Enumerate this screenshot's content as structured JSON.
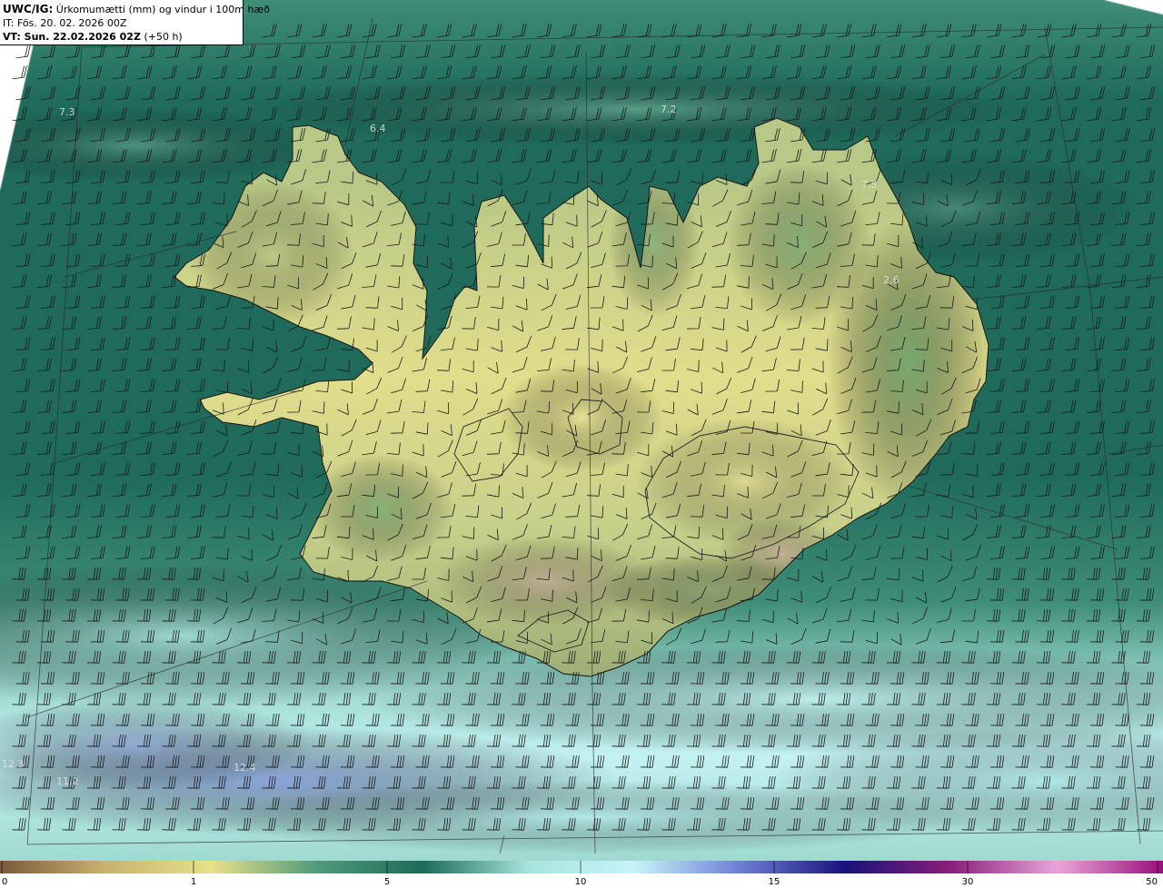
{
  "header": {
    "model_key": "UWC/IG:",
    "title": "Úrkomumætti (mm) og vindur i 100m hæð",
    "init_time": "IT: Fös. 20. 02. 2026 00Z",
    "valid_key": "VT: Sun. 22.02.2026 02Z",
    "lead": "(+50 h)"
  },
  "map_labels": [
    {
      "id": "label-ocean-nw",
      "text": "7.3"
    },
    {
      "id": "label-westfjords-north",
      "text": "6.4"
    },
    {
      "id": "label-north-coast",
      "text": "7.2"
    },
    {
      "id": "label-northeast",
      "text": "7.5"
    },
    {
      "id": "label-east",
      "text": "2.6"
    },
    {
      "id": "label-south-ocean-w",
      "text": "12.3"
    },
    {
      "id": "label-south-ocean",
      "text": "12.4"
    },
    {
      "id": "label-southwest-ocean",
      "text": "11.2"
    }
  ],
  "colorbar": {
    "ticks": [
      {
        "label": "0",
        "value": 0
      },
      {
        "label": "1",
        "value": 1
      },
      {
        "label": "5",
        "value": 5
      },
      {
        "label": "10",
        "value": 10
      },
      {
        "label": "15",
        "value": 15
      },
      {
        "label": "30",
        "value": 30
      },
      {
        "label": "50",
        "value": 50
      }
    ],
    "colors": [
      "#7a5a3c",
      "#c9b36f",
      "#e8e08a",
      "#4f9a7a",
      "#1f6b5a",
      "#a8e4de",
      "#c8f4f8",
      "#6f7fd6",
      "#18127a",
      "#8a1f7a",
      "#e8a6d8",
      "#9a0f7a"
    ]
  },
  "palette": {
    "ocean_deep": "#1f6a5a",
    "ocean_mid": "#3f8e78",
    "ocean_light": "#9fdad0",
    "south_cyan": "#c4f2f2",
    "south_blue": "#7d8ed8",
    "land_yellow": "#e2de8c",
    "land_green": "#5f9e6a",
    "mountain_pink": "#c89aa6"
  }
}
